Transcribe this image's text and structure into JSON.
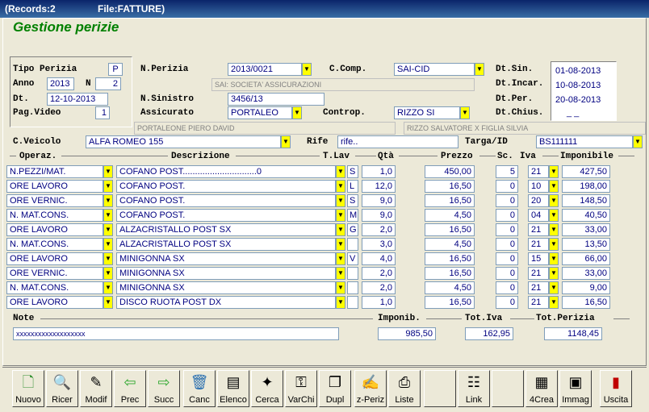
{
  "titlebar": {
    "records": "(Records:2",
    "file": "File:FATTURE)"
  },
  "app_title": "Gestione perizie",
  "left_panel": {
    "tipo_label": "Tipo Perizia",
    "tipo_value": "P",
    "anno_label": "Anno",
    "anno_value": "2013",
    "n_label": "N",
    "n_value": "2",
    "dt_label": "Dt.",
    "dt_value": "12-10-2013",
    "pagvideo_label": "Pag.Video",
    "pagvideo_value": "1"
  },
  "form": {
    "nperizia_label": "N.Perizia",
    "nperizia_value": "2013/0021",
    "ccomp_label": "C.Comp.",
    "ccomp_value": "SAI-CID",
    "ccomp_desc": "SAI: SOCIETA' ASSICURAZIONI",
    "nsinistro_label": "N.Sinistro",
    "nsinistro_value": "3456/13",
    "assicurato_label": "Assicurato",
    "assicurato_value": "PORTALEO",
    "assicurato_desc": "PORTALEONE PIERO DAVID",
    "contrope_label": "Controp.",
    "contrope_value": "RIZZO SI",
    "contrope_desc": "RIZZO SALVATORE X FIGLIA SILVIA",
    "cveicolo_label": "C.Veicolo",
    "cveicolo_value": "ALFA ROMEO 155",
    "rife_label": "Rife",
    "rife_value": "rife..",
    "targa_label": "Targa/ID",
    "targa_value": "BS111111"
  },
  "dates": {
    "dtsin_label": "Dt.Sin.",
    "dtsin_value": "01-08-2013",
    "dtincar_label": "Dt.Incar.",
    "dtincar_value": "10-08-2013",
    "dtper_label": "Dt.Per.",
    "dtper_value": "20-08-2013",
    "dtchius_label": "Dt.Chius.",
    "dtchius_value": "_ _"
  },
  "table": {
    "headers": {
      "operaz": "Operaz.",
      "descrizione": "Descrizione",
      "tlav": "T.Lav",
      "qta": "Qtà",
      "prezzo": "Prezzo",
      "sc": "Sc.",
      "iva": "Iva",
      "imponibile": "Imponibile"
    },
    "rows": [
      {
        "op": "N.PEZZI/MAT.",
        "desc": "COFANO POST..............................0",
        "tl": "S",
        "qta": "1,0",
        "prezzo": "450,00",
        "sc": "5",
        "iva": "21",
        "imp": "427,50"
      },
      {
        "op": "ORE LAVORO",
        "desc": "COFANO POST.",
        "tl": "L",
        "qta": "12,0",
        "prezzo": "16,50",
        "sc": "0",
        "iva": "10",
        "imp": "198,00"
      },
      {
        "op": "ORE VERNIC.",
        "desc": "COFANO POST.",
        "tl": "S",
        "qta": "9,0",
        "prezzo": "16,50",
        "sc": "0",
        "iva": "20",
        "imp": "148,50"
      },
      {
        "op": "N. MAT.CONS.",
        "desc": "COFANO POST.",
        "tl": "M",
        "qta": "9,0",
        "prezzo": "4,50",
        "sc": "0",
        "iva": "04",
        "imp": "40,50"
      },
      {
        "op": "ORE LAVORO",
        "desc": "ALZACRISTALLO POST SX",
        "tl": "G",
        "qta": "2,0",
        "prezzo": "16,50",
        "sc": "0",
        "iva": "21",
        "imp": "33,00"
      },
      {
        "op": "N. MAT.CONS.",
        "desc": "ALZACRISTALLO POST SX",
        "tl": "",
        "qta": "3,0",
        "prezzo": "4,50",
        "sc": "0",
        "iva": "21",
        "imp": "13,50"
      },
      {
        "op": "ORE LAVORO",
        "desc": "MINIGONNA SX",
        "tl": "V",
        "qta": "4,0",
        "prezzo": "16,50",
        "sc": "0",
        "iva": "15",
        "imp": "66,00"
      },
      {
        "op": "ORE VERNIC.",
        "desc": "MINIGONNA SX",
        "tl": "",
        "qta": "2,0",
        "prezzo": "16,50",
        "sc": "0",
        "iva": "21",
        "imp": "33,00"
      },
      {
        "op": "N. MAT.CONS.",
        "desc": "MINIGONNA SX",
        "tl": "",
        "qta": "2,0",
        "prezzo": "4,50",
        "sc": "0",
        "iva": "21",
        "imp": "9,00"
      },
      {
        "op": "ORE LAVORO",
        "desc": "DISCO RUOTA POST DX",
        "tl": "",
        "qta": "1,0",
        "prezzo": "16,50",
        "sc": "0",
        "iva": "21",
        "imp": "16,50"
      }
    ]
  },
  "footer": {
    "note_label": "Note",
    "note_value": "xxxxxxxxxxxxxxxxxxx",
    "imponib_label": "Imponib.",
    "imponib_value": "985,50",
    "totiva_label": "Tot.Iva",
    "totiva_value": "162,95",
    "totperizia_label": "Tot.Perizia",
    "totperizia_value": "1148,45"
  },
  "toolbar": {
    "buttons": [
      {
        "label": "Nuovo",
        "icon": "new-document-icon"
      },
      {
        "label": "Ricer",
        "icon": "search-icon"
      },
      {
        "label": "Modif",
        "icon": "edit-icon"
      },
      {
        "label": "Prec",
        "icon": "arrow-left-icon"
      },
      {
        "label": "Succ",
        "icon": "arrow-right-icon"
      },
      {
        "label": "Canc",
        "icon": "trash-icon"
      },
      {
        "label": "Elenco",
        "icon": "list-icon"
      },
      {
        "label": "Cerca",
        "icon": "find-icon"
      },
      {
        "label": "VarChi",
        "icon": "keys-icon"
      },
      {
        "label": "Dupl",
        "icon": "duplicate-icon"
      },
      {
        "label": "z-Periz",
        "icon": "report-icon"
      },
      {
        "label": "Liste",
        "icon": "printer-icon"
      },
      {
        "label": "Link",
        "icon": "link-icon"
      },
      {
        "label": "4Crea",
        "icon": "create-icon"
      },
      {
        "label": "Immag",
        "icon": "image-icon"
      },
      {
        "label": "Uscita",
        "icon": "exit-door-icon"
      }
    ]
  }
}
